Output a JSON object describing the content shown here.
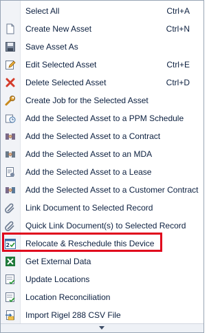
{
  "menu": {
    "items": [
      {
        "label": "Select All",
        "shortcut": "Ctrl+A",
        "icon": "none"
      },
      {
        "label": "Create New Asset",
        "shortcut": "Ctrl+N",
        "icon": "new-document-icon"
      },
      {
        "label": "Save Asset As",
        "shortcut": "",
        "icon": "save-icon"
      },
      {
        "label": "Edit Selected Asset",
        "shortcut": "Ctrl+E",
        "icon": "edit-pencil-icon"
      },
      {
        "label": "Delete Selected Asset",
        "shortcut": "Ctrl+D",
        "icon": "delete-x-icon"
      },
      {
        "label": "Create Job for the Selected Asset",
        "shortcut": "",
        "icon": "wrench-icon"
      },
      {
        "label": "Add the Selected Asset to a PPM Schedule",
        "shortcut": "",
        "icon": "schedule-clock-icon"
      },
      {
        "label": "Add the Selected Asset to a Contract",
        "shortcut": "",
        "icon": "contract-handshake-icon"
      },
      {
        "label": "Add the Selected Asset to an MDA",
        "shortcut": "",
        "icon": "mda-icon"
      },
      {
        "label": "Add the Selected Asset to a Lease",
        "shortcut": "",
        "icon": "lease-icon"
      },
      {
        "label": "Add the Selected Asset to a Customer Contract",
        "shortcut": "",
        "icon": "customer-contract-icon"
      },
      {
        "label": "Link Document to Selected Record",
        "shortcut": "",
        "icon": "paperclip-icon"
      },
      {
        "label": "Quick Link Document(s) to Selected Record",
        "shortcut": "",
        "icon": "quick-paperclip-icon"
      },
      {
        "label": "Relocate & Reschedule this Device",
        "shortcut": "",
        "icon": "relocate-calendar-icon"
      },
      {
        "label": "Get External Data",
        "shortcut": "",
        "icon": "excel-icon"
      },
      {
        "label": "Update Locations",
        "shortcut": "",
        "icon": "update-locations-icon"
      },
      {
        "label": "Location Reconciliation",
        "shortcut": "",
        "icon": "reconciliation-icon"
      },
      {
        "label": "Import Rigel 288 CSV File",
        "shortcut": "",
        "icon": "import-folder-icon"
      }
    ],
    "highlighted_item": "Relocate & Reschedule this Device"
  },
  "colors": {
    "highlight_border": "#e0001b",
    "text": "#0b1f3f",
    "menu_border": "#97a4b4"
  }
}
